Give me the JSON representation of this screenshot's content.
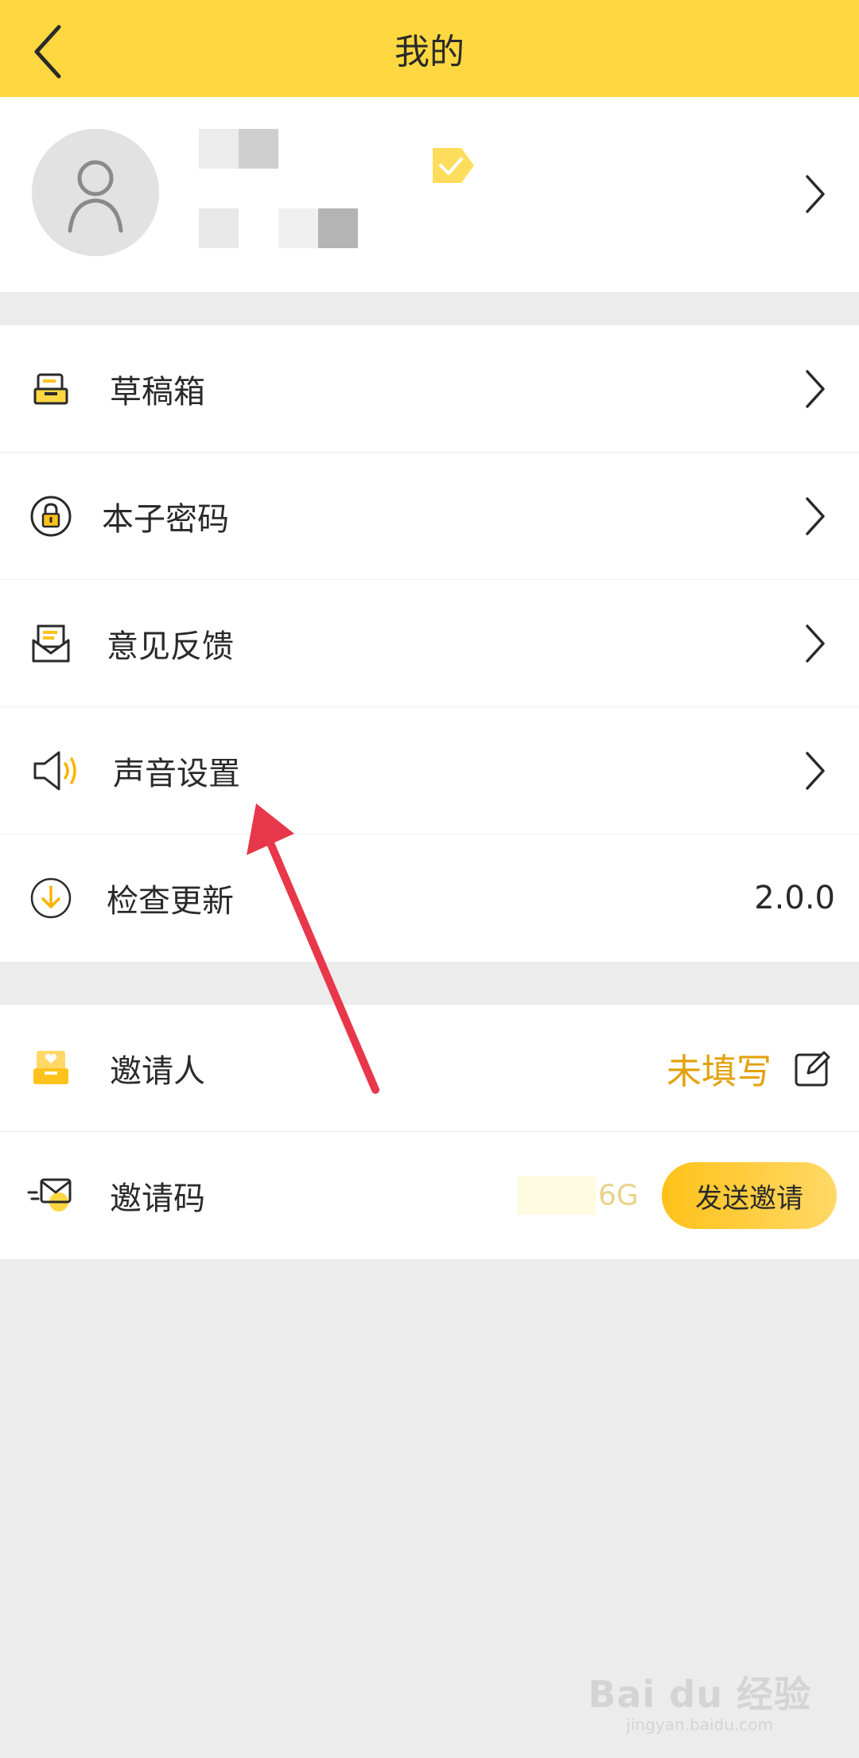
{
  "header": {
    "title": "我的",
    "back_icon": "chevron-left-icon",
    "background": "#ffd740"
  },
  "profile": {
    "avatar_icon": "user-avatar-icon",
    "badge_icon": "verified-badge-icon",
    "chevron_icon": "chevron-right-icon"
  },
  "menu": {
    "items": [
      {
        "label": "草稿箱",
        "icon": "drafts-box-icon"
      },
      {
        "label": "本子密码",
        "icon": "lock-icon"
      },
      {
        "label": "意见反馈",
        "icon": "feedback-envelope-icon"
      },
      {
        "label": "声音设置",
        "icon": "speaker-icon"
      },
      {
        "label": "检查更新",
        "icon": "download-update-icon",
        "value": "2.0.0"
      }
    ]
  },
  "invite": {
    "inviter_label": "邀请人",
    "inviter_status": "未填写",
    "inviter_icon": "heart-inbox-icon",
    "edit_icon": "edit-icon",
    "code_label": "邀请码",
    "code_icon": "send-mail-icon",
    "code_tail": "6G",
    "send_button": "发送邀请"
  },
  "annotation": {
    "arrow_color": "#e8374a"
  },
  "watermark": {
    "brand": "Bai du 经验",
    "url": "jingyan.baidu.com"
  },
  "colors": {
    "accent": "#ffd740",
    "status_orange": "#e2a20c",
    "page_bg": "#ececec"
  }
}
